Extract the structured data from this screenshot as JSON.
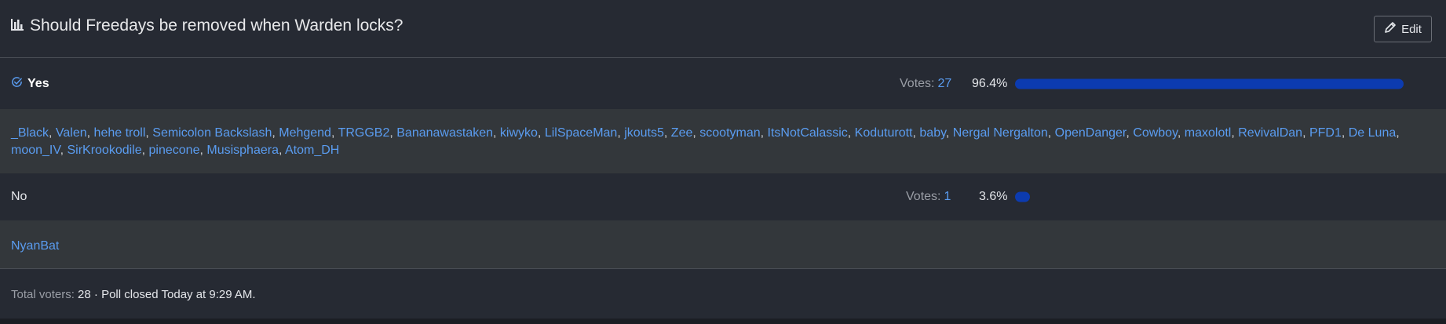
{
  "poll": {
    "title": "Should Freedays be removed when Warden locks?",
    "edit_label": "Edit",
    "votes_label": "Votes:",
    "choices": [
      {
        "label": "Yes",
        "voted": true,
        "votes": "27",
        "percent_text": "96.4%",
        "percent": 96.4,
        "voters": [
          "_Black",
          "Valen",
          "hehe troll",
          "Semicolon Backslash",
          "Mehgend",
          "TRGGB2",
          "Bananawastaken",
          "kiwyko",
          "LilSpaceMan",
          "jkouts5",
          "Zee",
          "scootyman",
          "ItsNotCalassic",
          "Koduturott",
          "baby",
          "Nergal Nergalton",
          "OpenDanger",
          "Cowboy",
          "maxolotl",
          "RevivalDan",
          "PFD1",
          "De Luna",
          "moon_IV",
          "SirKrookodile",
          "pinecone",
          "Musisphaera",
          "Atom_DH"
        ]
      },
      {
        "label": "No",
        "voted": false,
        "votes": "1",
        "percent_text": "3.6%",
        "percent": 3.6,
        "voters": [
          "NyanBat"
        ]
      }
    ],
    "footer": {
      "total_label": "Total voters:",
      "total_value": "28",
      "separator": "·",
      "closed_text": "Poll closed Today at 9:29 AM."
    }
  },
  "colors": {
    "accent": "#5a9cf0",
    "bar": "#0c3bb0"
  },
  "icons": {
    "title": "bar-chart-icon",
    "edit": "pencil-icon",
    "voted": "check-circle-icon"
  }
}
